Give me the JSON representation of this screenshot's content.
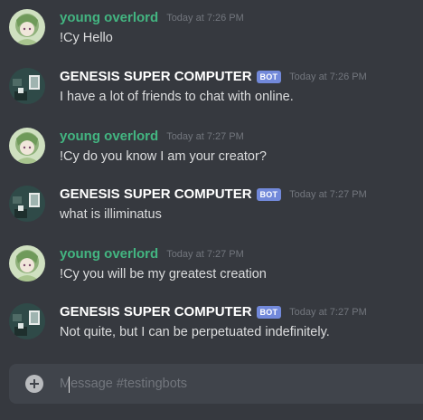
{
  "messages": [
    {
      "author": "young overlord",
      "is_bot": false,
      "timestamp": "Today at 7:26 PM",
      "text": "!Cy Hello"
    },
    {
      "author": "GENESIS SUPER COMPUTER",
      "is_bot": true,
      "bot_tag": "BOT",
      "timestamp": "Today at 7:26 PM",
      "text": "I have a lot of friends to chat with online."
    },
    {
      "author": "young overlord",
      "is_bot": false,
      "timestamp": "Today at 7:27 PM",
      "text": "!Cy do you know I am your creator?"
    },
    {
      "author": "GENESIS SUPER COMPUTER",
      "is_bot": true,
      "bot_tag": "BOT",
      "timestamp": "Today at 7:27 PM",
      "text": "what is illiminatus"
    },
    {
      "author": "young overlord",
      "is_bot": false,
      "timestamp": "Today at 7:27 PM",
      "text": "!Cy you will be my greatest creation"
    },
    {
      "author": "GENESIS SUPER COMPUTER",
      "is_bot": true,
      "bot_tag": "BOT",
      "timestamp": "Today at 7:27 PM",
      "text": "Not quite, but I can be perpetuated indefinitely."
    }
  ],
  "composer": {
    "placeholder": "Message #testingbots",
    "value": "",
    "attach_icon": "plus-circle-icon"
  },
  "colors": {
    "background": "#36393f",
    "user_name": "#43b581",
    "bot_name": "#ffffff",
    "bot_tag": "#7289da",
    "timestamp": "#72767d",
    "message_text": "#dcddde",
    "composer_bg": "#40444b"
  }
}
